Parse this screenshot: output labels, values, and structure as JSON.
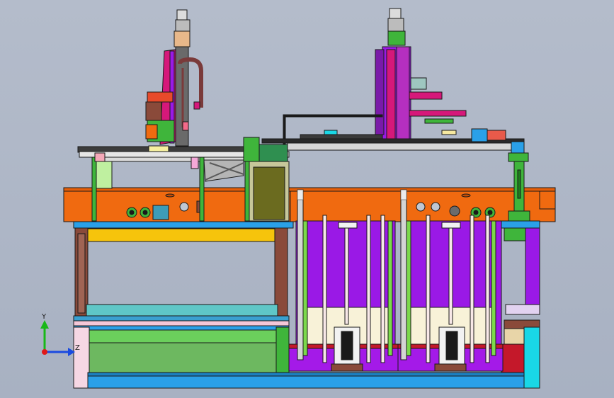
{
  "view": {
    "background": "#aeb6c6",
    "edge_color": "#1a1a1a"
  },
  "palette": {
    "orange": "#f06a10",
    "purple": "#9a19e6",
    "magenta": "#d6187a",
    "green": "#3fb53b",
    "light_green": "#8fe07c",
    "blue": "#2aa0e8",
    "cyan": "#19d7e6",
    "olive": "#6b6b1f",
    "brown": "#8a4a3a",
    "pink": "#f4c7d8",
    "yellow": "#f6c40c",
    "teal": "#5fc7c7",
    "lavender": "#c78cf0"
  },
  "triad": {
    "x_label": "Z",
    "y_label": "Y",
    "y_color": "#18b818",
    "z_color": "#1a4ae0",
    "origin_color": "#e01818"
  }
}
